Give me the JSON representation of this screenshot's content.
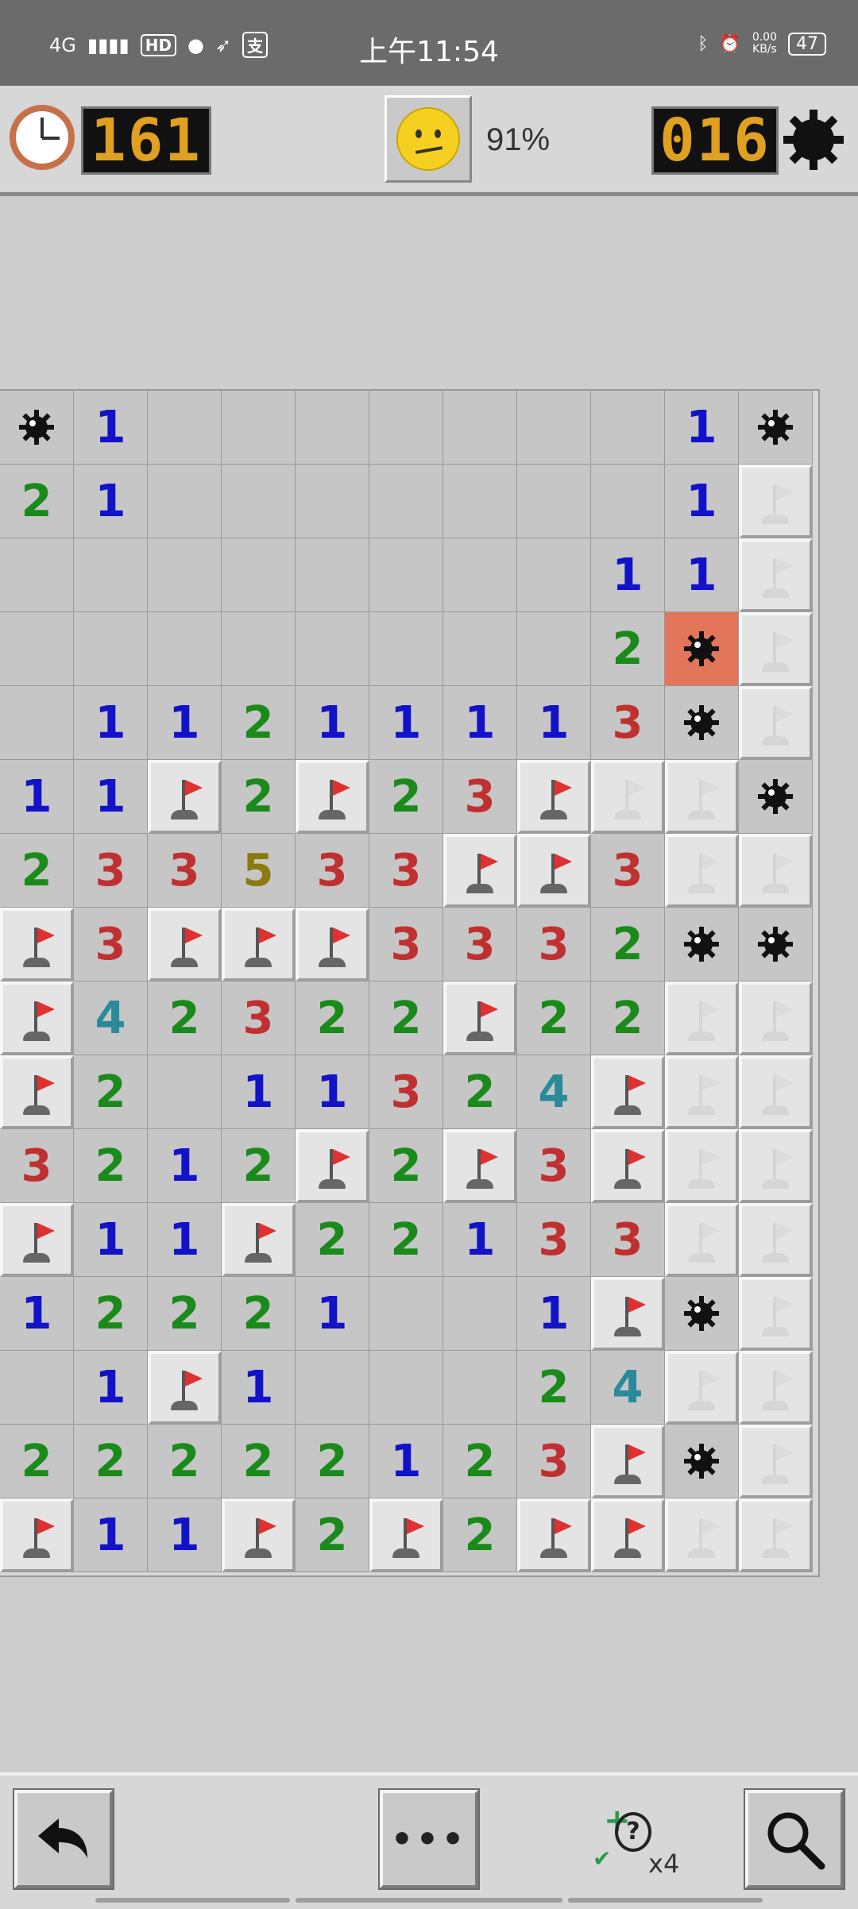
{
  "status_bar": {
    "time": "上午11:54",
    "network": "4G",
    "hd": "HD",
    "pay_icon": "支",
    "speed_value": "0.00",
    "speed_unit": "KB/s",
    "battery": "47"
  },
  "header": {
    "timer": "161",
    "progress": "91%",
    "mines_left": "016"
  },
  "board": {
    "cols": 11,
    "rows": 16,
    "cells": [
      [
        "m",
        "1",
        "o",
        "o",
        "o",
        "o",
        "o",
        "o",
        "o",
        "1",
        "m"
      ],
      [
        "2",
        "1",
        "o",
        "o",
        "o",
        "o",
        "o",
        "o",
        "o",
        "1",
        "g"
      ],
      [
        "o",
        "o",
        "o",
        "o",
        "o",
        "o",
        "o",
        "o",
        "1",
        "1",
        "g"
      ],
      [
        "o",
        "o",
        "o",
        "o",
        "o",
        "o",
        "o",
        "o",
        "2",
        "x",
        "g"
      ],
      [
        "o",
        "1",
        "1",
        "2",
        "1",
        "1",
        "1",
        "1",
        "3",
        "m",
        "g"
      ],
      [
        "1",
        "1",
        "f",
        "2",
        "f",
        "2",
        "3",
        "f",
        "g",
        "g",
        "m"
      ],
      [
        "2",
        "3",
        "3",
        "5",
        "3",
        "3",
        "f",
        "f",
        "3",
        "g",
        "g"
      ],
      [
        "f",
        "3",
        "f",
        "f",
        "f",
        "3",
        "3",
        "3",
        "2",
        "m",
        "m"
      ],
      [
        "f",
        "4",
        "2",
        "3",
        "2",
        "2",
        "f",
        "2",
        "2",
        "g",
        "g"
      ],
      [
        "f",
        "2",
        "o",
        "1",
        "1",
        "3",
        "2",
        "4",
        "f",
        "g",
        "g"
      ],
      [
        "3",
        "2",
        "1",
        "2",
        "f",
        "2",
        "f",
        "3",
        "f",
        "g",
        "g"
      ],
      [
        "f",
        "1",
        "1",
        "f",
        "2",
        "2",
        "1",
        "3",
        "3",
        "g",
        "g"
      ],
      [
        "1",
        "2",
        "2",
        "2",
        "1",
        "o",
        "o",
        "1",
        "f",
        "m",
        "g"
      ],
      [
        "o",
        "1",
        "f",
        "1",
        "o",
        "o",
        "o",
        "2",
        "4",
        "g",
        "g"
      ],
      [
        "2",
        "2",
        "2",
        "2",
        "2",
        "1",
        "2",
        "3",
        "f",
        "m",
        "g"
      ],
      [
        "f",
        "1",
        "1",
        "f",
        "2",
        "f",
        "2",
        "f",
        "f",
        "g",
        "g"
      ]
    ]
  },
  "bottom": {
    "more_label": "•••",
    "hint_count": "x4",
    "hint_symbol": "?"
  }
}
